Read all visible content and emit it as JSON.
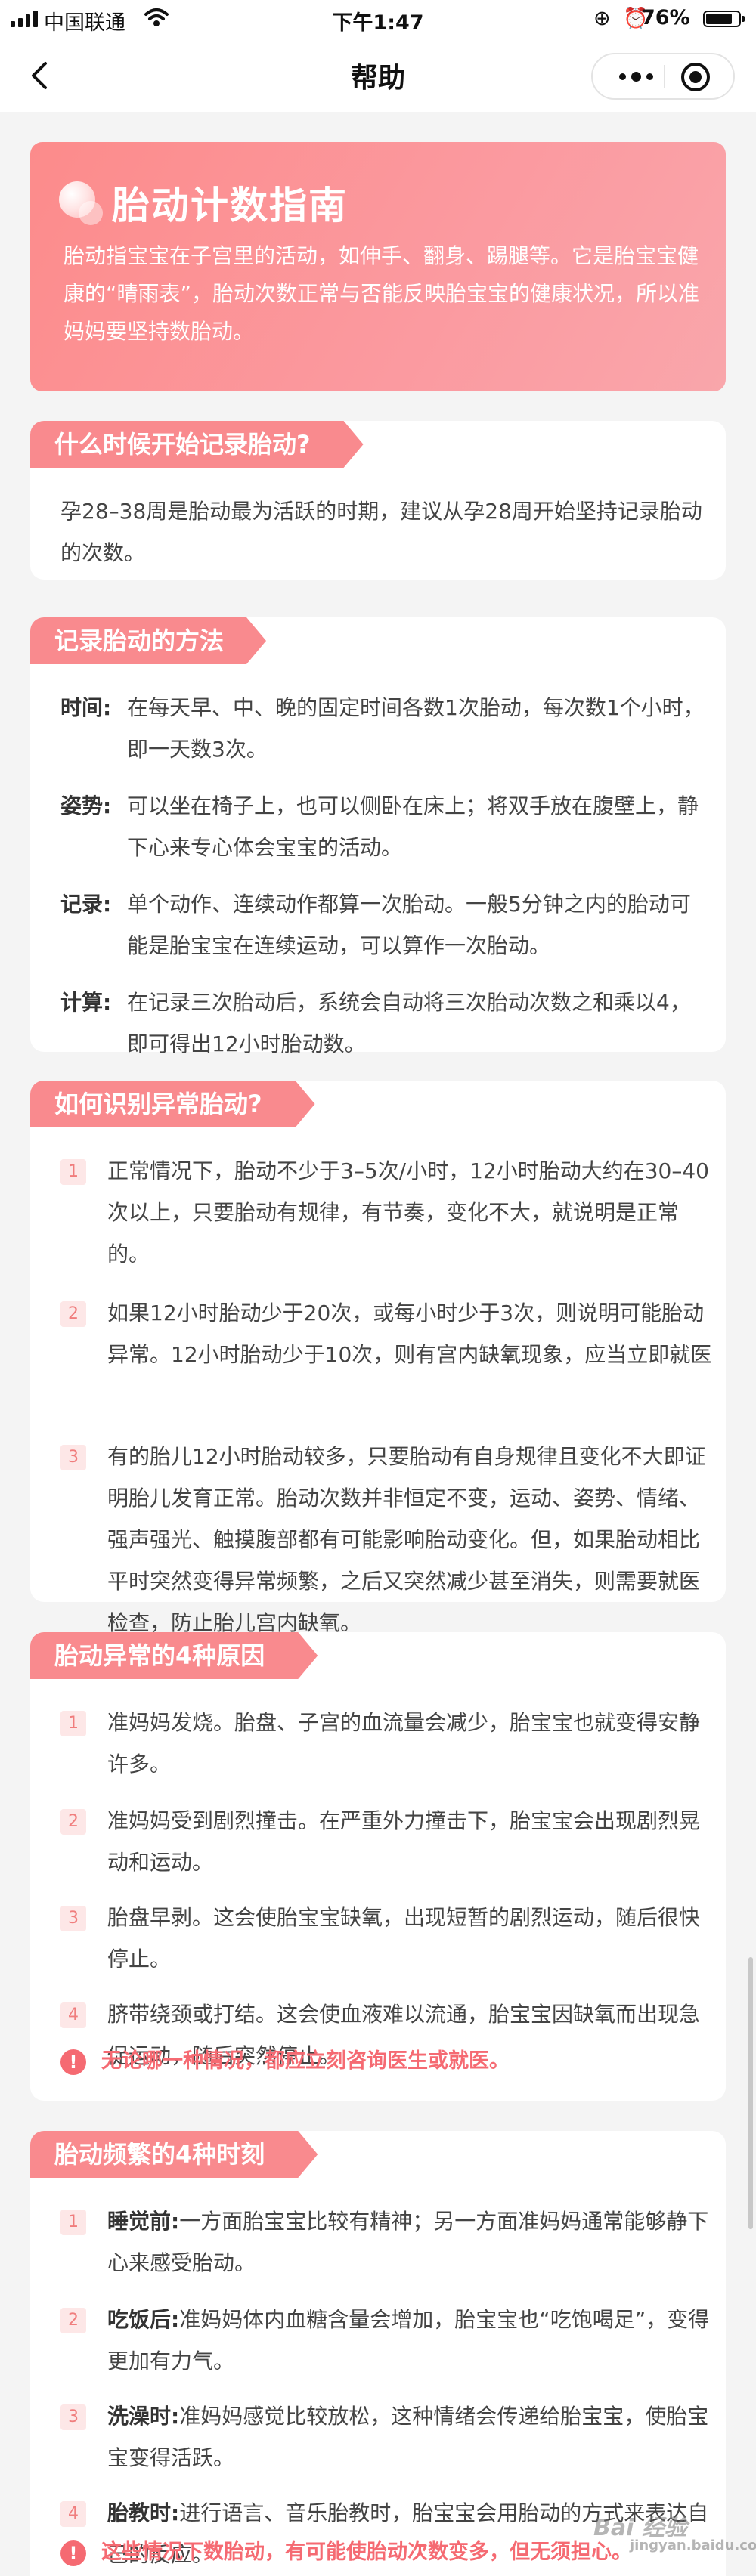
{
  "status_bar": {
    "carrier": "中国联通",
    "time": "下午1:47",
    "battery": "76%",
    "icons": "⊕ ⏰"
  },
  "nav": {
    "title": "帮助"
  },
  "hero": {
    "title": "胎动计数指南",
    "desc": "胎动指宝宝在子宫里的活动，如伸手、翻身、踢腿等。它是胎宝宝健康的“晴雨表”，胎动次数正常与否能反映胎宝宝的健康状况，所以准妈妈要坚持数胎动。"
  },
  "when": {
    "title": "什么时候开始记录胎动?",
    "text": "孕28–38周是胎动最为活跃的时期，建议从孕28周开始坚持记录胎动的次数。"
  },
  "method": {
    "title": "记录胎动的方法",
    "rows": [
      {
        "label": "时间:",
        "text": "在每天早、中、晚的固定时间各数1次胎动，每次数1个小时，即一天数3次。"
      },
      {
        "label": "姿势:",
        "text": "可以坐在椅子上，也可以侧卧在床上；将双手放在腹壁上，静下心来专心体会宝宝的活动。"
      },
      {
        "label": "记录:",
        "text": "单个动作、连续动作都算一次胎动。一般5分钟之内的胎动可能是胎宝宝在连续运动，可以算作一次胎动。"
      },
      {
        "label": "计算:",
        "text": "在记录三次胎动后，系统会自动将三次胎动次数之和乘以4，即可得出12小时胎动数。"
      }
    ]
  },
  "abnormal": {
    "title": "如何识别异常胎动?",
    "items": [
      {
        "num": "1",
        "text": "正常情况下，胎动不少于3–5次/小时，12小时胎动大约在30–40次以上，只要胎动有规律，有节奏，变化不大，就说明是正常的。"
      },
      {
        "num": "2",
        "text": "如果12小时胎动少于20次，或每小时少于3次，则说明可能胎动异常。12小时胎动少于10次，则有宫内缺氧现象，应当立即就医"
      },
      {
        "num": "3",
        "text": "有的胎儿12小时胎动较多，只要胎动有自身规律且变化不大即证明胎儿发育正常。胎动次数并非恒定不变，运动、姿势、情绪、强声强光、触摸腹部都有可能影响胎动变化。但，如果胎动相比平时突然变得异常频繁，之后又突然减少甚至消失，则需要就医检查，防止胎儿宫内缺氧。"
      }
    ]
  },
  "reasons": {
    "title": "胎动异常的4种原因",
    "items": [
      {
        "num": "1",
        "text": "准妈妈发烧。胎盘、子宫的血流量会减少，胎宝宝也就变得安静许多。"
      },
      {
        "num": "2",
        "text": "准妈妈受到剧烈撞击。在严重外力撞击下，胎宝宝会出现剧烈晃动和运动。"
      },
      {
        "num": "3",
        "text": "胎盘早剥。这会使胎宝宝缺氧，出现短暂的剧烈运动，随后很快停止。"
      },
      {
        "num": "4",
        "text": "脐带绕颈或打结。这会使血液难以流通，胎宝宝因缺氧而出现急促运动，随后突然停止。"
      }
    ],
    "warning": "无论哪一种情况，都应立刻咨询医生或就医。"
  },
  "frequent": {
    "title": "胎动频繁的4种时刻",
    "items": [
      {
        "num": "1",
        "label": "睡觉前:",
        "text": "一方面胎宝宝比较有精神；另一方面准妈妈通常能够静下心来感受胎动。"
      },
      {
        "num": "2",
        "label": "吃饭后:",
        "text": "准妈妈体内血糖含量会增加，胎宝宝也“吃饱喝足”，变得更加有力气。"
      },
      {
        "num": "3",
        "label": "洗澡时:",
        "text": "准妈妈感觉比较放松，这种情绪会传递给胎宝宝，使胎宝宝变得活跃。"
      },
      {
        "num": "4",
        "label": "胎教时:",
        "text": "进行语言、音乐胎教时，胎宝宝会用胎动的方式来表达自己的反应。"
      }
    ],
    "warning": "这些情况下数胎动，有可能使胎动次数变多，但无须担心。"
  },
  "watermark": {
    "text": "Bai 经验",
    "sub": "jingyan.baidu.com"
  },
  "colors": {
    "accent": "#f98a8e",
    "warning": "#f56a72",
    "hero_start": "#fc8b8b",
    "hero_end": "#f9a6ab"
  }
}
